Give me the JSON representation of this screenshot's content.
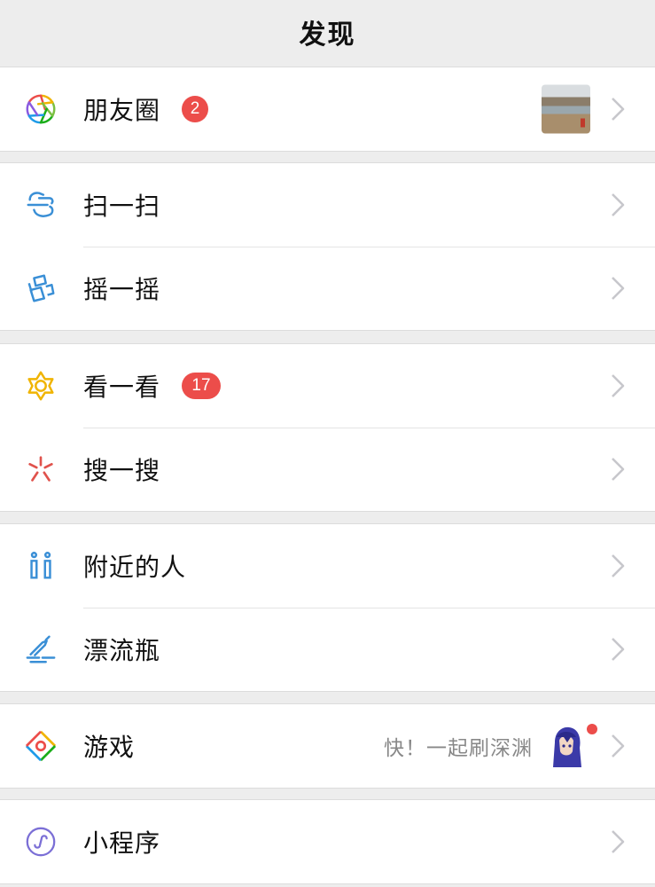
{
  "header": {
    "title": "发现"
  },
  "colors": {
    "background": "#ededed",
    "badge": "#ec4d4a",
    "chevron": "#c7c7cc"
  },
  "items": {
    "moments": {
      "label": "朋友圈",
      "badge": "2",
      "icon": "moments-aperture-icon"
    },
    "scan": {
      "label": "扫一扫",
      "icon": "scan-icon"
    },
    "shake": {
      "label": "摇一摇",
      "icon": "shake-phone-icon"
    },
    "toplook": {
      "label": "看一看",
      "badge": "17",
      "icon": "top-stories-star-icon"
    },
    "search": {
      "label": "搜一搜",
      "icon": "search-burst-icon"
    },
    "nearby": {
      "label": "附近的人",
      "icon": "people-nearby-icon"
    },
    "bottle": {
      "label": "漂流瓶",
      "icon": "drift-bottle-icon"
    },
    "games": {
      "label": "游戏",
      "subtitle": "快！一起刷深渊",
      "icon": "games-diamond-icon"
    },
    "miniprog": {
      "label": "小程序",
      "icon": "mini-program-icon"
    }
  }
}
